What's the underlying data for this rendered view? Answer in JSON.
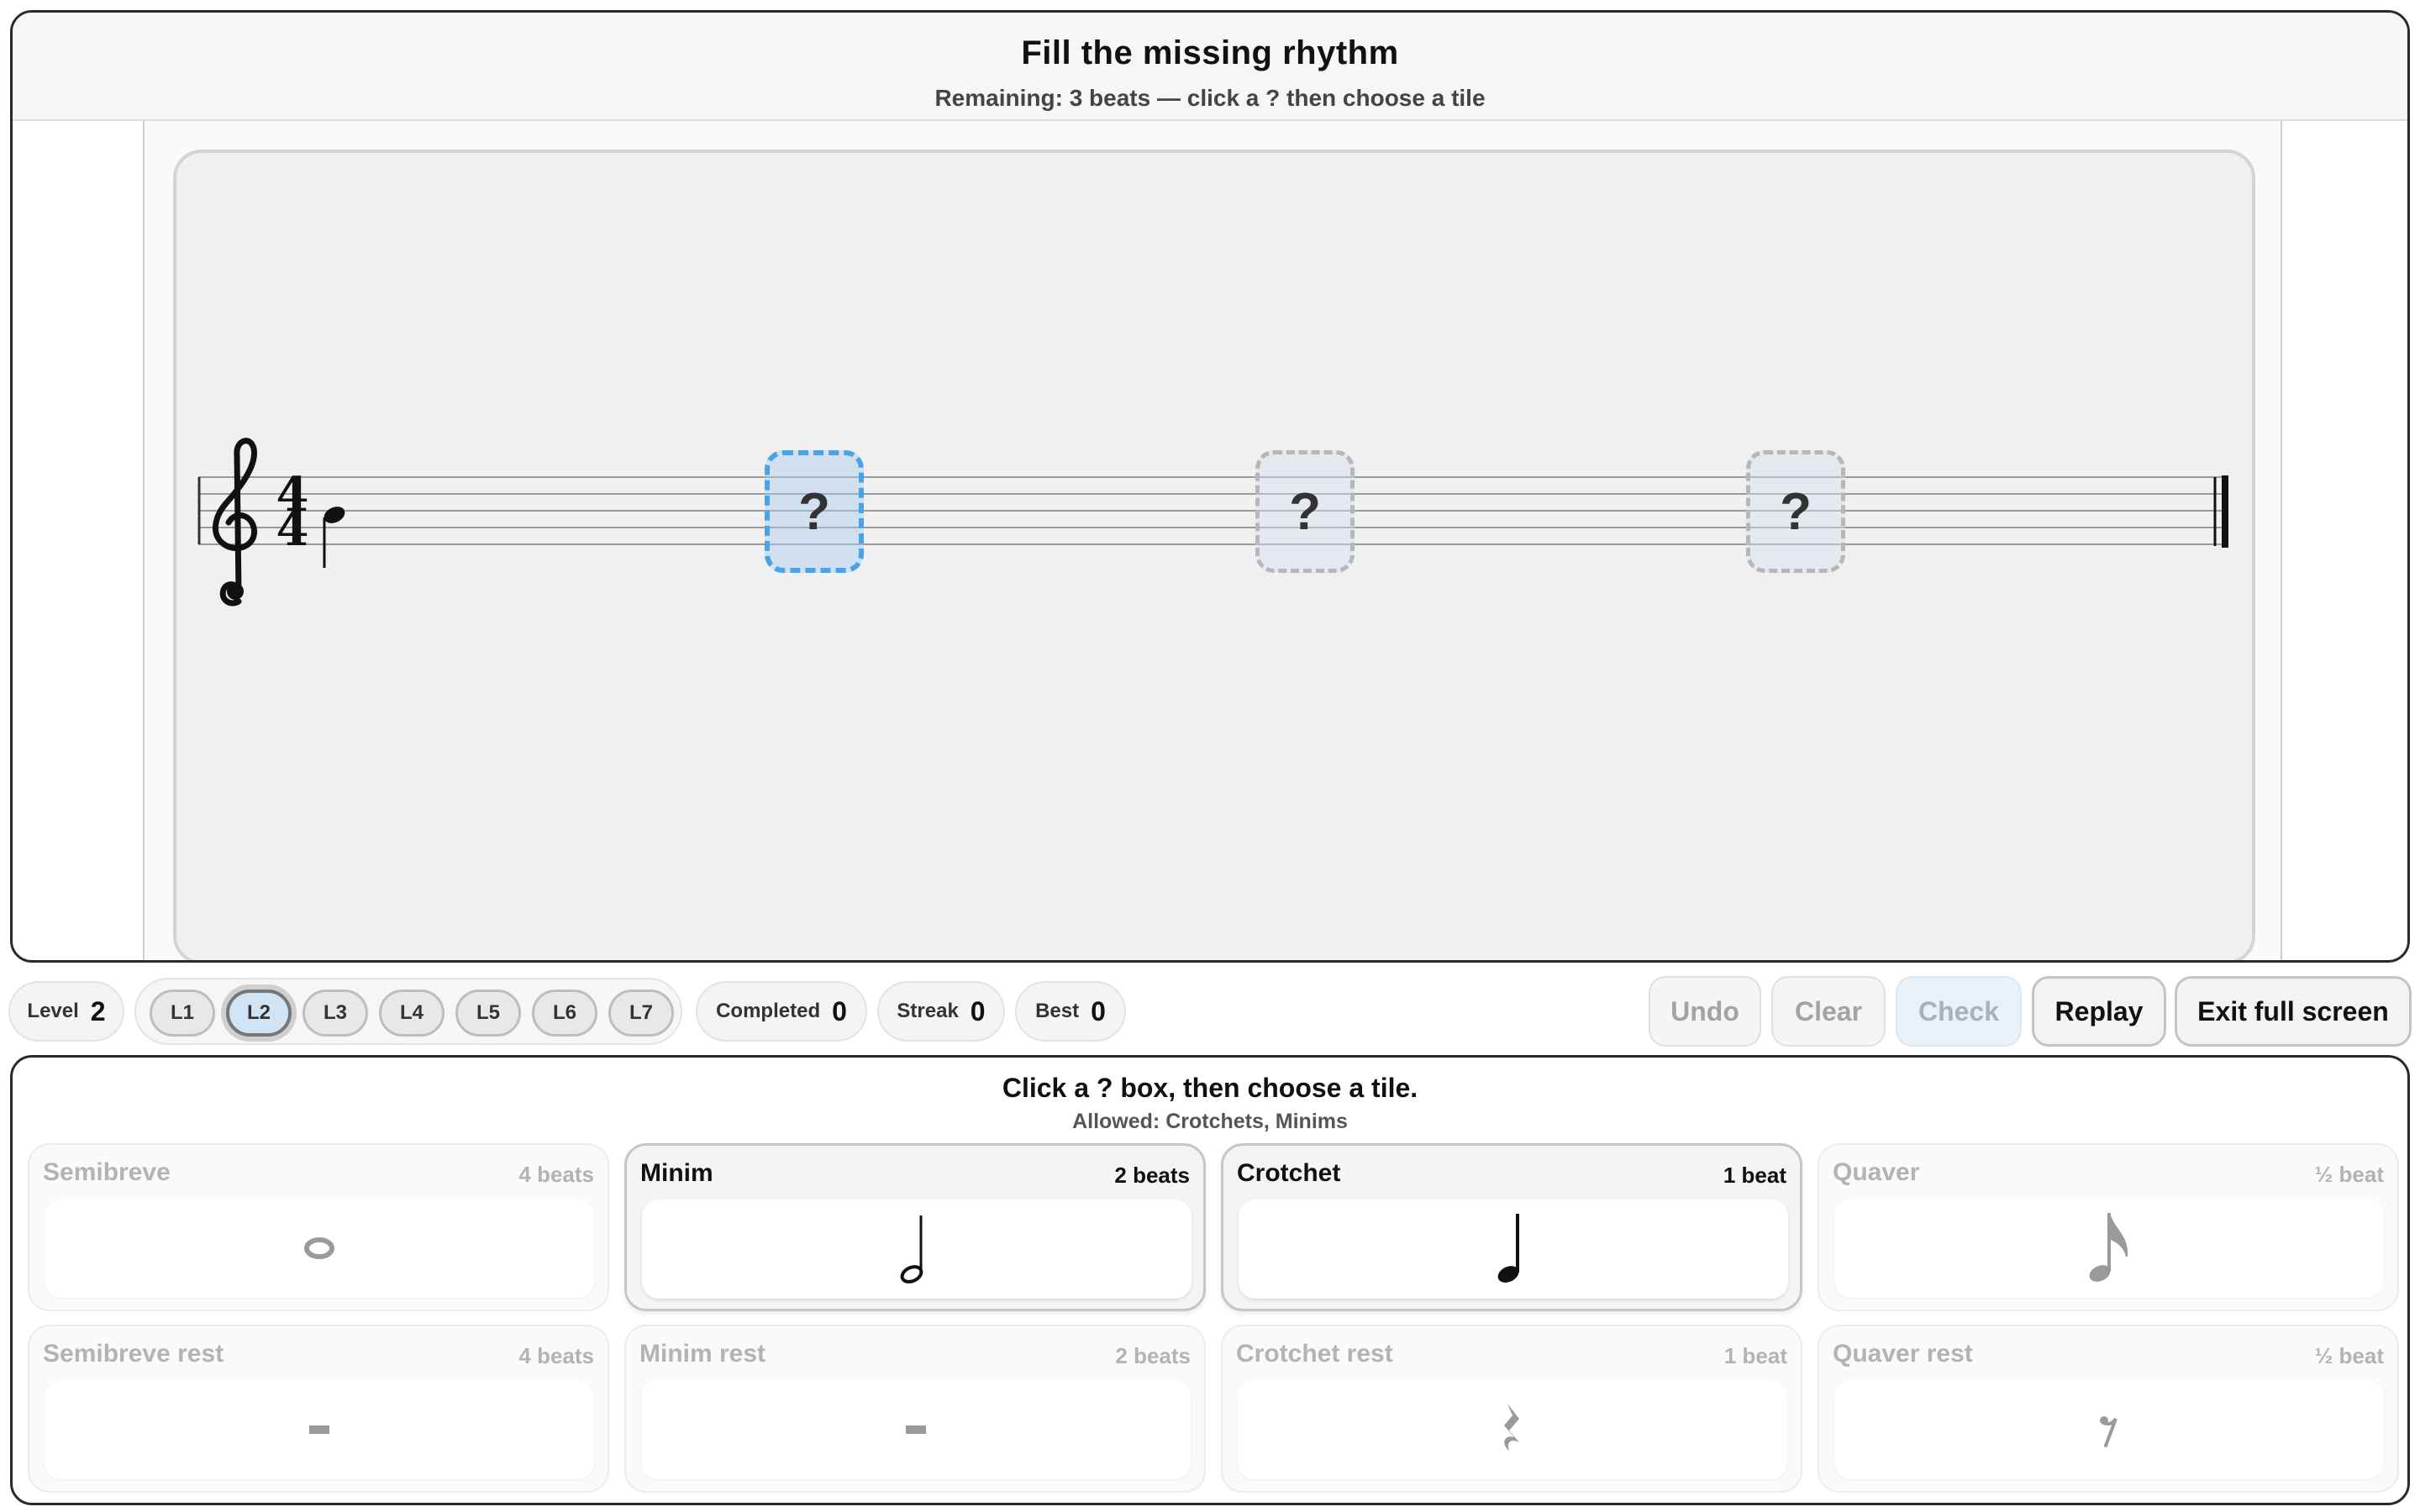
{
  "header": {
    "title": "Fill the missing rhythm",
    "subtitle": "Remaining: 3 beats — click a ? then choose a tile"
  },
  "score": {
    "clef": "treble-clef-icon",
    "time_signature": {
      "top": "4",
      "bottom": "4"
    },
    "given_note": "crotchet",
    "slots": [
      {
        "label": "?",
        "active": true
      },
      {
        "label": "?",
        "active": false
      },
      {
        "label": "?",
        "active": false
      }
    ]
  },
  "stats": {
    "level_label": "Level",
    "level_value": "2",
    "completed_label": "Completed",
    "completed_value": "0",
    "streak_label": "Streak",
    "streak_value": "0",
    "best_label": "Best",
    "best_value": "0"
  },
  "levels": [
    {
      "label": "L1",
      "selected": false
    },
    {
      "label": "L2",
      "selected": true
    },
    {
      "label": "L3",
      "selected": false
    },
    {
      "label": "L4",
      "selected": false
    },
    {
      "label": "L5",
      "selected": false
    },
    {
      "label": "L6",
      "selected": false
    },
    {
      "label": "L7",
      "selected": false
    }
  ],
  "actions": {
    "undo": "Undo",
    "clear": "Clear",
    "check": "Check",
    "replay": "Replay",
    "exit_full_screen": "Exit full screen"
  },
  "palette": {
    "instruction": "Click a ? box, then choose a tile.",
    "allowed": "Allowed: Crotchets, Minims",
    "tiles": [
      {
        "name": "Semibreve",
        "beats": "4 beats",
        "enabled": false,
        "icon": "semibreve-icon"
      },
      {
        "name": "Minim",
        "beats": "2 beats",
        "enabled": true,
        "icon": "minim-icon"
      },
      {
        "name": "Crotchet",
        "beats": "1 beat",
        "enabled": true,
        "icon": "crotchet-icon"
      },
      {
        "name": "Quaver",
        "beats": "½ beat",
        "enabled": false,
        "icon": "quaver-icon"
      },
      {
        "name": "Semibreve rest",
        "beats": "4 beats",
        "enabled": false,
        "icon": "semibreve-rest-icon"
      },
      {
        "name": "Minim rest",
        "beats": "2 beats",
        "enabled": false,
        "icon": "minim-rest-icon"
      },
      {
        "name": "Crotchet rest",
        "beats": "1 beat",
        "enabled": false,
        "icon": "crotchet-rest-icon"
      },
      {
        "name": "Quaver rest",
        "beats": "½ beat",
        "enabled": false,
        "icon": "quaver-rest-icon"
      }
    ]
  },
  "colors": {
    "active_slot": "#4aa3e6",
    "selected_level": "#cfe4f5",
    "enabled_ink": "#111111",
    "disabled_ink": "#b3b3b3"
  }
}
